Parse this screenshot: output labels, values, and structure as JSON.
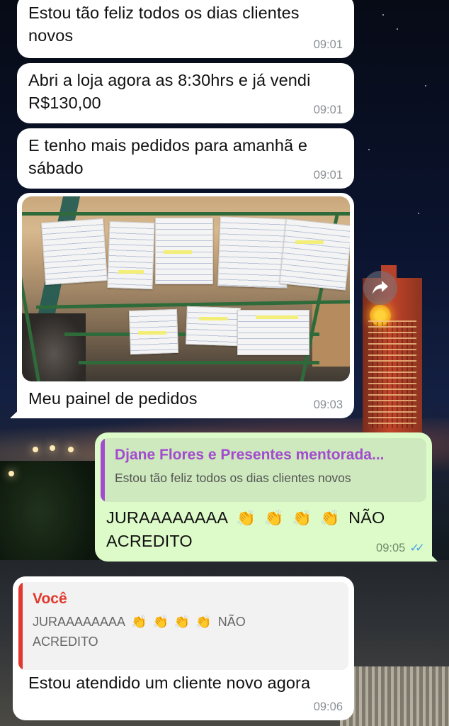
{
  "messages": [
    {
      "text": "Estou tão feliz todos os dias clientes novos",
      "time": "09:01"
    },
    {
      "text": "Abri a loja agora as 8:30hrs e já vendi R$130,00",
      "time": "09:01"
    },
    {
      "text": "E tenho mais pedidos para amanhã e sábado",
      "time": "09:01"
    },
    {
      "caption": "Meu painel de pedidos",
      "time": "09:03"
    }
  ],
  "reply_out": {
    "quoted_author": "Djane Flores e Presentes mentorada...",
    "quoted_author_color": "#a34bcf",
    "quoted_text": "Estou tão feliz todos os dias clientes novos",
    "text_line1_a": "JURAAAAAAAA",
    "claps": "👏",
    "text_line1_b": "NÃO",
    "text_line2": "ACREDITO",
    "time": "09:05",
    "ticks": "✓✓"
  },
  "reply_in": {
    "quoted_author": "Você",
    "quoted_author_color": "#e2382d",
    "quoted_text_a": "JURAAAAAAAA",
    "quoted_text_b": "NÃO",
    "quoted_text_c": "ACREDITO",
    "text": "Estou atendido um cliente novo agora",
    "time": "09:06"
  },
  "icons": {
    "share": "share-forward-icon"
  }
}
